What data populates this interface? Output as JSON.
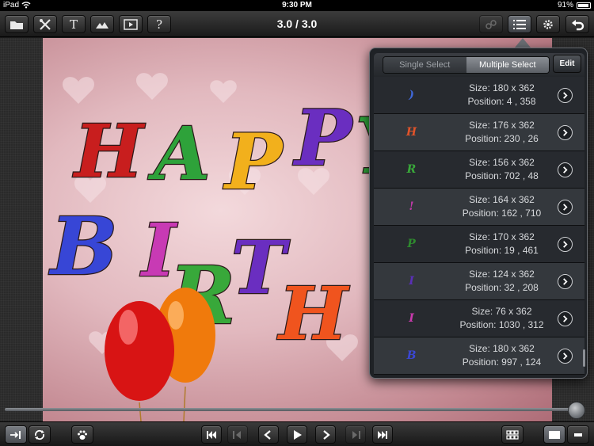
{
  "status_bar": {
    "device": "iPad",
    "time": "9:30 PM",
    "battery": "91%"
  },
  "toolbar": {
    "counter": "3.0 / 3.0",
    "text_tool_glyph": "T",
    "help_glyph": "?"
  },
  "canvas": {
    "title_letters_line1": [
      "H",
      "A",
      "P",
      "P",
      "Y"
    ],
    "title_letters_line2": [
      "B",
      "I",
      "R",
      "T",
      "H"
    ]
  },
  "popover": {
    "segments": [
      "Single Select",
      "Multiple Select"
    ],
    "selected_segment": "Multiple Select",
    "edit_label": "Edit",
    "layers": [
      {
        "glyph": ")",
        "color": "#3f67d8",
        "size": "Size: 180 x 362",
        "position": "Position: 4 , 358"
      },
      {
        "glyph": "H",
        "color": "#e0532a",
        "size": "Size: 176 x 362",
        "position": "Position: 230 , 26"
      },
      {
        "glyph": "R",
        "color": "#39a83a",
        "size": "Size: 156 x 362",
        "position": "Position: 702 , 48"
      },
      {
        "glyph": "!",
        "color": "#c03aa8",
        "size": "Size: 164 x 362",
        "position": "Position: 162 , 710"
      },
      {
        "glyph": "P",
        "color": "#2e8a2e",
        "size": "Size: 170 x 362",
        "position": "Position: 19 , 461"
      },
      {
        "glyph": "I",
        "color": "#5a2fb8",
        "size": "Size: 124 x 362",
        "position": "Position: 32 , 208"
      },
      {
        "glyph": "I",
        "color": "#c93aae",
        "size": "Size: 76 x 362",
        "position": "Position: 1030 , 312"
      },
      {
        "glyph": "B",
        "color": "#3b47d4",
        "size": "Size: 180 x 362",
        "position": "Position: 997 , 124"
      }
    ]
  },
  "scrubber": {
    "progress": 1.0
  },
  "colors": {
    "accent": "#8b8f95",
    "canvas_bg": "#e2b9bf"
  },
  "icons": {
    "toolbar_left": [
      "folder-icon",
      "tools-icon",
      "text-icon",
      "image-icon",
      "video-icon",
      "help-icon"
    ],
    "toolbar_right": [
      "link-icon",
      "layers-list-icon",
      "settings-icon",
      "undo-icon"
    ],
    "bottom": [
      "align-right-icon",
      "loop-icon",
      "paw-icon",
      "skip-back-icon",
      "prev-keyframe-icon",
      "prev-icon",
      "play-icon",
      "next-icon",
      "next-keyframe-icon",
      "skip-forward-icon",
      "timeline-icon",
      "view-single-icon",
      "view-split-icon"
    ]
  }
}
